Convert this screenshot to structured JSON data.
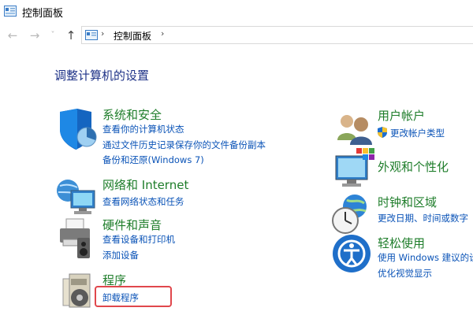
{
  "window": {
    "title": "控制面板"
  },
  "nav": {
    "back_icon": "←",
    "forward_icon": "→",
    "recent_icon": "˅",
    "up_icon": "↑",
    "breadcrumb_sep": "›",
    "breadcrumb": "控制面板"
  },
  "heading": "调整计算机的设置",
  "categories": [
    {
      "title": "系统和安全",
      "icon": "shield-icon",
      "links": [
        "查看你的计算机状态",
        "通过文件历史记录保存你的文件备份副本",
        "备份和还原(Windows 7)"
      ]
    },
    {
      "title": "网络和 Internet",
      "icon": "network-icon",
      "links": [
        "查看网络状态和任务"
      ]
    },
    {
      "title": "硬件和声音",
      "icon": "printer-icon",
      "links": [
        "查看设备和打印机",
        "添加设备"
      ]
    },
    {
      "title": "程序",
      "icon": "programs-icon",
      "links": [
        "卸载程序"
      ]
    },
    {
      "title": "用户帐户",
      "icon": "users-icon",
      "links": [
        "更改帐户类型"
      ]
    },
    {
      "title": "外观和个性化",
      "icon": "monitor-icon",
      "links": []
    },
    {
      "title": "时钟和区域",
      "icon": "clock-globe-icon",
      "links": [
        "更改日期、时间或数字"
      ]
    },
    {
      "title": "轻松使用",
      "icon": "ease-of-access-icon",
      "links": [
        "使用 Windows 建议的设",
        "优化视觉显示"
      ]
    }
  ],
  "colors": {
    "category_title": "#1e7d2a",
    "link": "#0a53b7",
    "heading": "#1e3287",
    "highlight": "#e0474c"
  }
}
